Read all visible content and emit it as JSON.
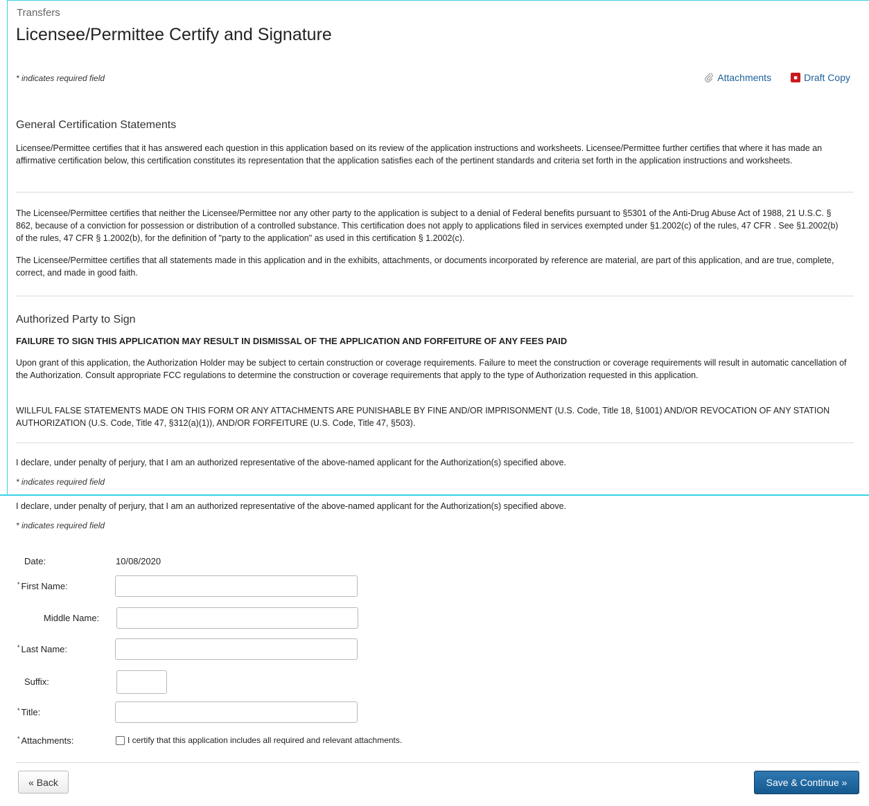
{
  "breadcrumb": "Transfers",
  "title": "Licensee/Permittee Certify and Signature",
  "required_note": "* indicates required field",
  "links": {
    "attachments": "Attachments",
    "draft_copy": "Draft Copy"
  },
  "general": {
    "heading": "General Certification Statements",
    "p1": "Licensee/Permittee certifies that it has answered each question in this application based on its review of the application instructions and worksheets. Licensee/Permittee further certifies that where it has made an affirmative certification below, this certification constitutes its representation that the application satisfies each of the pertinent standards and criteria set forth in the application instructions and worksheets.",
    "p2": "The Licensee/Permittee certifies that neither the Licensee/Permittee nor any other party to the application is subject to a denial of Federal benefits pursuant to §5301 of the Anti-Drug Abuse Act of 1988, 21 U.S.C. § 862, because of a conviction for possession or distribution of a controlled substance. This certification does not apply to applications filed in services exempted under §1.2002(c) of the rules, 47 CFR . See §1.2002(b) of the rules, 47 CFR § 1.2002(b), for the definition of \"party to the application\" as used in this certification § 1.2002(c).",
    "p3": "The Licensee/Permittee certifies that all statements made in this application and in the exhibits, attachments, or documents incorporated by reference are material, are part of this application, and are true, complete, correct, and made in good faith."
  },
  "authorized": {
    "heading": "Authorized Party to Sign",
    "warning": "FAILURE TO SIGN THIS APPLICATION MAY RESULT IN DISMISSAL OF THE APPLICATION AND FORFEITURE OF ANY FEES PAID",
    "p1": "Upon grant of this application, the Authorization Holder may be subject to certain construction or coverage requirements. Failure to meet the construction or coverage requirements will result in automatic cancellation of the Authorization. Consult appropriate FCC regulations to determine the construction or coverage requirements that apply to the type of Authorization requested in this application.",
    "p2": "WILLFUL FALSE STATEMENTS MADE ON THIS FORM OR ANY ATTACHMENTS ARE PUNISHABLE BY FINE AND/OR IMPRISONMENT (U.S. Code, Title 18, §1001) AND/OR REVOCATION OF ANY STATION AUTHORIZATION (U.S. Code, Title 47, §312(a)(1)), AND/OR FORFEITURE (U.S. Code, Title 47, §503).",
    "declare": "I declare, under penalty of perjury, that I am an authorized representative of the above-named applicant for the Authorization(s) specified above."
  },
  "form": {
    "required_mark": "*",
    "date_label": "Date:",
    "date_value": "10/08/2020",
    "first_name_label": "First Name:",
    "first_name_value": "",
    "middle_name_label": "Middle Name:",
    "middle_name_value": "",
    "last_name_label": "Last Name:",
    "last_name_value": "",
    "suffix_label": "Suffix:",
    "suffix_value": "",
    "title_label": "Title:",
    "title_value": "",
    "attachments_label": "Attachments:",
    "attachments_cert": "I certify that this application includes all required and relevant attachments.",
    "attachments_checked": false
  },
  "buttons": {
    "back": "« Back",
    "save": "Save & Continue »"
  }
}
